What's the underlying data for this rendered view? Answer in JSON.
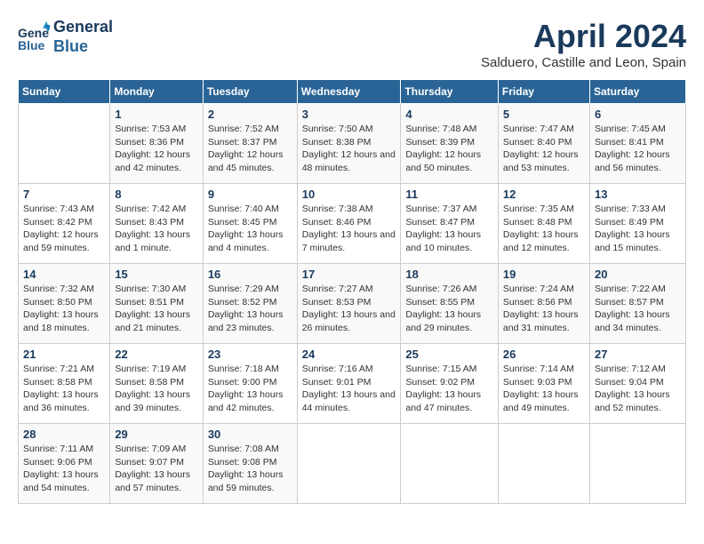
{
  "logo": {
    "line1": "General",
    "line2": "Blue"
  },
  "title": "April 2024",
  "subtitle": "Salduero, Castille and Leon, Spain",
  "weekdays": [
    "Sunday",
    "Monday",
    "Tuesday",
    "Wednesday",
    "Thursday",
    "Friday",
    "Saturday"
  ],
  "weeks": [
    [
      {
        "day": "",
        "sunrise": "",
        "sunset": "",
        "daylight": ""
      },
      {
        "day": "1",
        "sunrise": "Sunrise: 7:53 AM",
        "sunset": "Sunset: 8:36 PM",
        "daylight": "Daylight: 12 hours and 42 minutes."
      },
      {
        "day": "2",
        "sunrise": "Sunrise: 7:52 AM",
        "sunset": "Sunset: 8:37 PM",
        "daylight": "Daylight: 12 hours and 45 minutes."
      },
      {
        "day": "3",
        "sunrise": "Sunrise: 7:50 AM",
        "sunset": "Sunset: 8:38 PM",
        "daylight": "Daylight: 12 hours and 48 minutes."
      },
      {
        "day": "4",
        "sunrise": "Sunrise: 7:48 AM",
        "sunset": "Sunset: 8:39 PM",
        "daylight": "Daylight: 12 hours and 50 minutes."
      },
      {
        "day": "5",
        "sunrise": "Sunrise: 7:47 AM",
        "sunset": "Sunset: 8:40 PM",
        "daylight": "Daylight: 12 hours and 53 minutes."
      },
      {
        "day": "6",
        "sunrise": "Sunrise: 7:45 AM",
        "sunset": "Sunset: 8:41 PM",
        "daylight": "Daylight: 12 hours and 56 minutes."
      }
    ],
    [
      {
        "day": "7",
        "sunrise": "Sunrise: 7:43 AM",
        "sunset": "Sunset: 8:42 PM",
        "daylight": "Daylight: 12 hours and 59 minutes."
      },
      {
        "day": "8",
        "sunrise": "Sunrise: 7:42 AM",
        "sunset": "Sunset: 8:43 PM",
        "daylight": "Daylight: 13 hours and 1 minute."
      },
      {
        "day": "9",
        "sunrise": "Sunrise: 7:40 AM",
        "sunset": "Sunset: 8:45 PM",
        "daylight": "Daylight: 13 hours and 4 minutes."
      },
      {
        "day": "10",
        "sunrise": "Sunrise: 7:38 AM",
        "sunset": "Sunset: 8:46 PM",
        "daylight": "Daylight: 13 hours and 7 minutes."
      },
      {
        "day": "11",
        "sunrise": "Sunrise: 7:37 AM",
        "sunset": "Sunset: 8:47 PM",
        "daylight": "Daylight: 13 hours and 10 minutes."
      },
      {
        "day": "12",
        "sunrise": "Sunrise: 7:35 AM",
        "sunset": "Sunset: 8:48 PM",
        "daylight": "Daylight: 13 hours and 12 minutes."
      },
      {
        "day": "13",
        "sunrise": "Sunrise: 7:33 AM",
        "sunset": "Sunset: 8:49 PM",
        "daylight": "Daylight: 13 hours and 15 minutes."
      }
    ],
    [
      {
        "day": "14",
        "sunrise": "Sunrise: 7:32 AM",
        "sunset": "Sunset: 8:50 PM",
        "daylight": "Daylight: 13 hours and 18 minutes."
      },
      {
        "day": "15",
        "sunrise": "Sunrise: 7:30 AM",
        "sunset": "Sunset: 8:51 PM",
        "daylight": "Daylight: 13 hours and 21 minutes."
      },
      {
        "day": "16",
        "sunrise": "Sunrise: 7:29 AM",
        "sunset": "Sunset: 8:52 PM",
        "daylight": "Daylight: 13 hours and 23 minutes."
      },
      {
        "day": "17",
        "sunrise": "Sunrise: 7:27 AM",
        "sunset": "Sunset: 8:53 PM",
        "daylight": "Daylight: 13 hours and 26 minutes."
      },
      {
        "day": "18",
        "sunrise": "Sunrise: 7:26 AM",
        "sunset": "Sunset: 8:55 PM",
        "daylight": "Daylight: 13 hours and 29 minutes."
      },
      {
        "day": "19",
        "sunrise": "Sunrise: 7:24 AM",
        "sunset": "Sunset: 8:56 PM",
        "daylight": "Daylight: 13 hours and 31 minutes."
      },
      {
        "day": "20",
        "sunrise": "Sunrise: 7:22 AM",
        "sunset": "Sunset: 8:57 PM",
        "daylight": "Daylight: 13 hours and 34 minutes."
      }
    ],
    [
      {
        "day": "21",
        "sunrise": "Sunrise: 7:21 AM",
        "sunset": "Sunset: 8:58 PM",
        "daylight": "Daylight: 13 hours and 36 minutes."
      },
      {
        "day": "22",
        "sunrise": "Sunrise: 7:19 AM",
        "sunset": "Sunset: 8:58 PM",
        "daylight": "Daylight: 13 hours and 39 minutes."
      },
      {
        "day": "23",
        "sunrise": "Sunrise: 7:18 AM",
        "sunset": "Sunset: 9:00 PM",
        "daylight": "Daylight: 13 hours and 42 minutes."
      },
      {
        "day": "24",
        "sunrise": "Sunrise: 7:16 AM",
        "sunset": "Sunset: 9:01 PM",
        "daylight": "Daylight: 13 hours and 44 minutes."
      },
      {
        "day": "25",
        "sunrise": "Sunrise: 7:15 AM",
        "sunset": "Sunset: 9:02 PM",
        "daylight": "Daylight: 13 hours and 47 minutes."
      },
      {
        "day": "26",
        "sunrise": "Sunrise: 7:14 AM",
        "sunset": "Sunset: 9:03 PM",
        "daylight": "Daylight: 13 hours and 49 minutes."
      },
      {
        "day": "27",
        "sunrise": "Sunrise: 7:12 AM",
        "sunset": "Sunset: 9:04 PM",
        "daylight": "Daylight: 13 hours and 52 minutes."
      }
    ],
    [
      {
        "day": "28",
        "sunrise": "Sunrise: 7:11 AM",
        "sunset": "Sunset: 9:06 PM",
        "daylight": "Daylight: 13 hours and 54 minutes."
      },
      {
        "day": "29",
        "sunrise": "Sunrise: 7:09 AM",
        "sunset": "Sunset: 9:07 PM",
        "daylight": "Daylight: 13 hours and 57 minutes."
      },
      {
        "day": "30",
        "sunrise": "Sunrise: 7:08 AM",
        "sunset": "Sunset: 9:08 PM",
        "daylight": "Daylight: 13 hours and 59 minutes."
      },
      {
        "day": "",
        "sunrise": "",
        "sunset": "",
        "daylight": ""
      },
      {
        "day": "",
        "sunrise": "",
        "sunset": "",
        "daylight": ""
      },
      {
        "day": "",
        "sunrise": "",
        "sunset": "",
        "daylight": ""
      },
      {
        "day": "",
        "sunrise": "",
        "sunset": "",
        "daylight": ""
      }
    ]
  ]
}
